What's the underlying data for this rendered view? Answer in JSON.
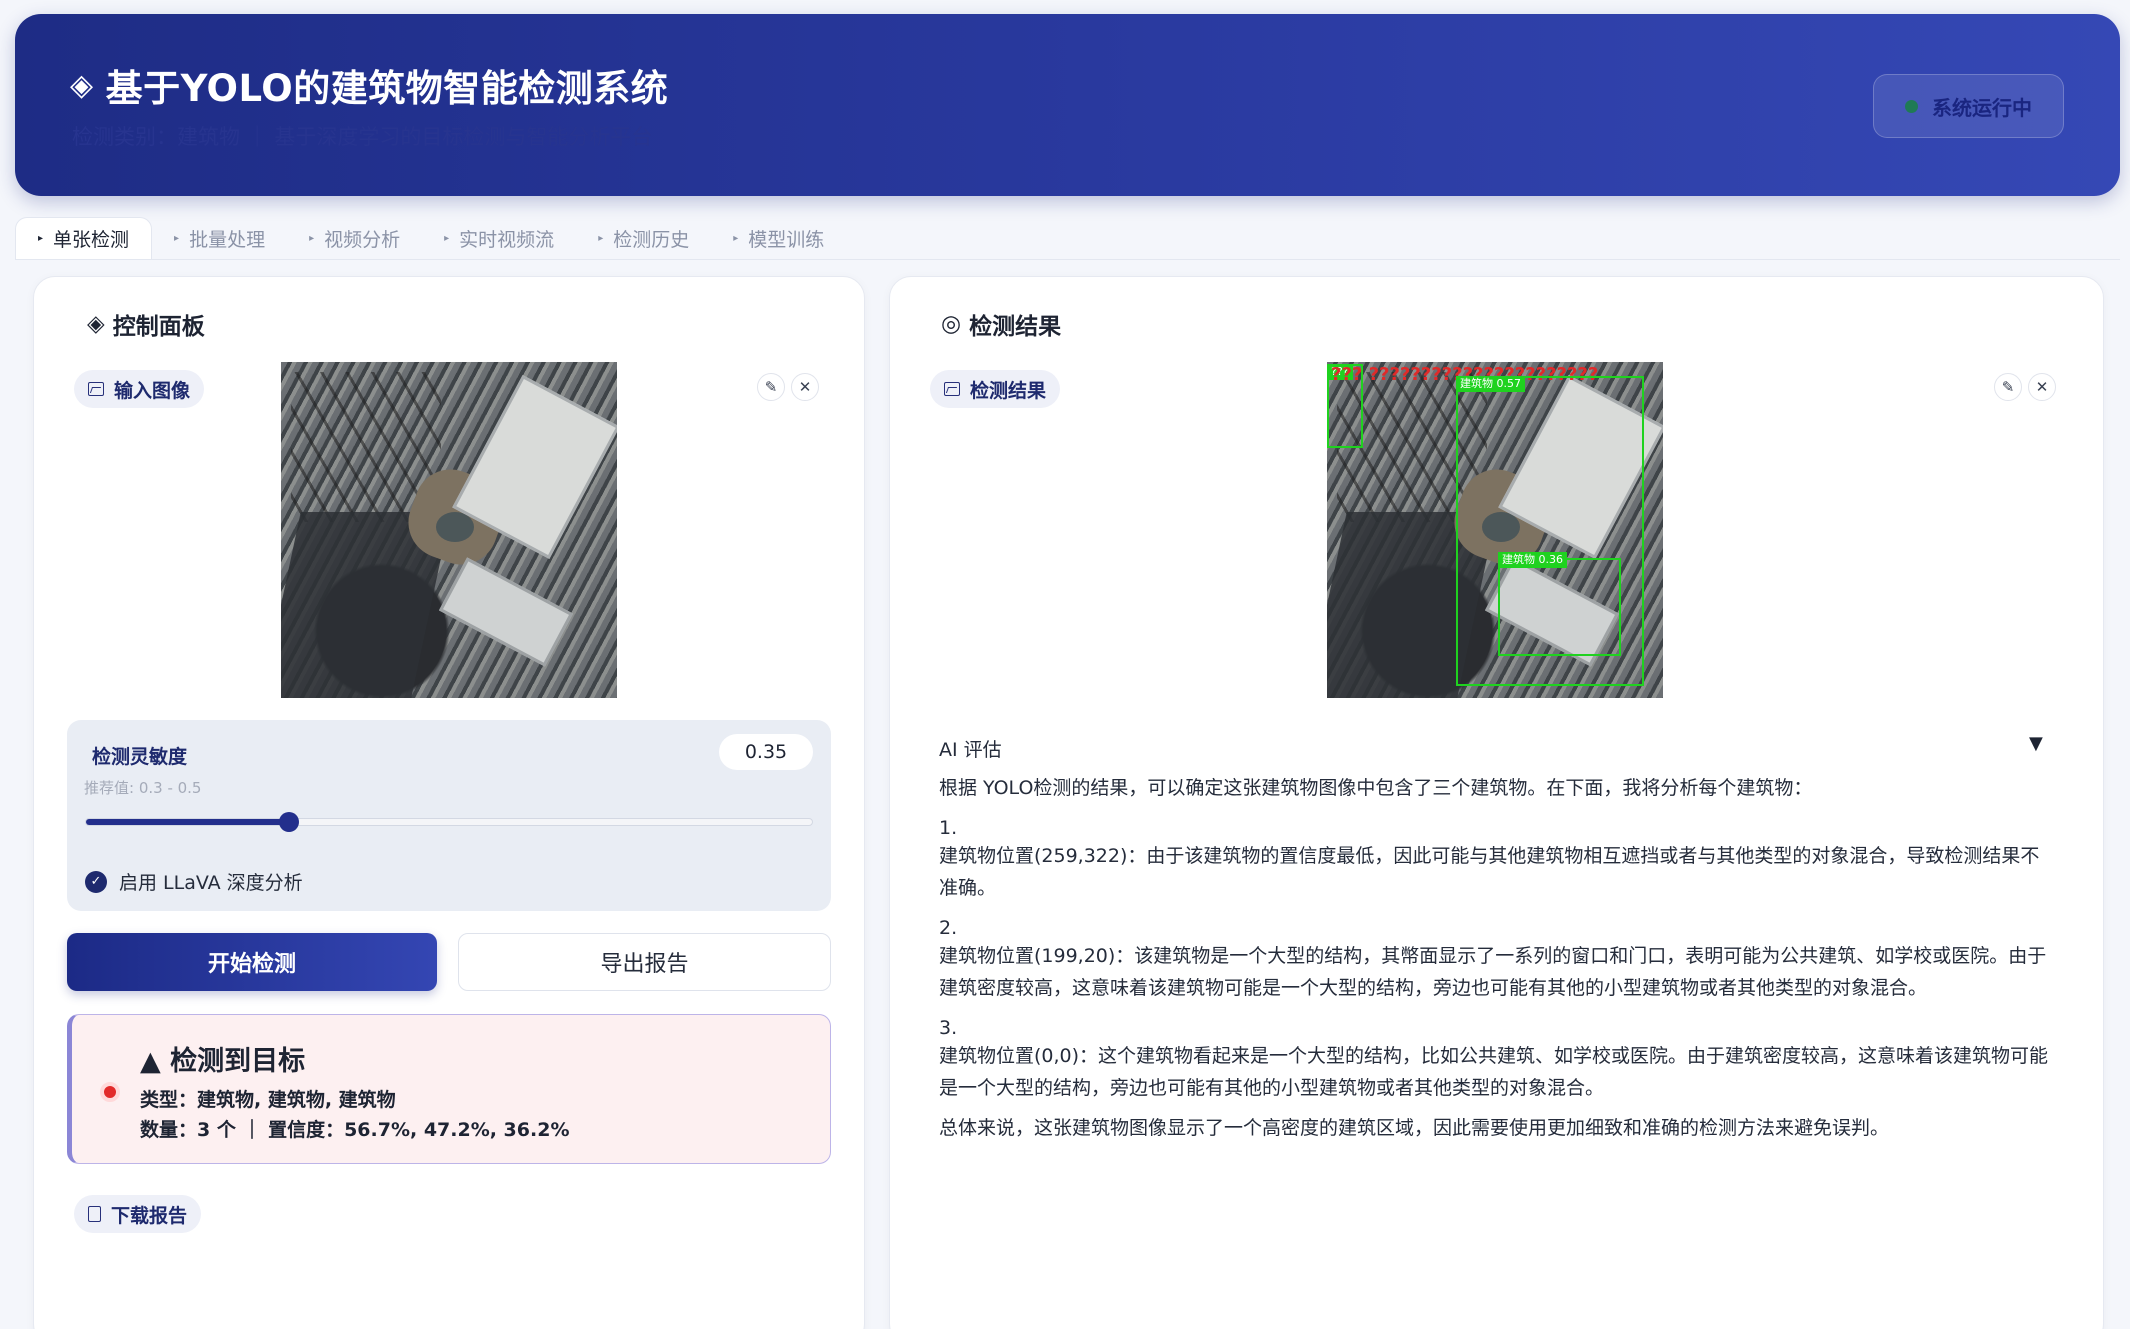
{
  "header": {
    "title": "基于YOLO的建筑物智能检测系统",
    "subtitle": "检测类别：建筑物 ｜ 基于深度学习的目标检测与智能分析平台",
    "status": "系统运行中"
  },
  "tabs": [
    {
      "label": "单张检测",
      "active": true
    },
    {
      "label": "批量处理"
    },
    {
      "label": "视频分析"
    },
    {
      "label": "实时视频流"
    },
    {
      "label": "检测历史"
    },
    {
      "label": "模型训练"
    }
  ],
  "control": {
    "title": "控制面板",
    "input_label": "输入图像",
    "sensitivity": {
      "label": "检测灵敏度",
      "hint": "推荐值: 0.3 - 0.5",
      "value": "0.35",
      "fraction": 0.28
    },
    "llava_label": "启用 LLaVA 深度分析",
    "llava_checked": true,
    "start_button": "开始检测",
    "export_button": "导出报告",
    "alert": {
      "title": "▲ 检测到目标",
      "types": "类型：建筑物, 建筑物, 建筑物",
      "summary": "数量：3 个 ｜ 置信度：56.7%, 47.2%, 36.2%"
    },
    "download_label": "下载报告"
  },
  "result": {
    "title": "检测结果",
    "chip_label": "检测结果",
    "detections": [
      {
        "label": "???",
        "garbled": "??? ??????????????????????"
      },
      {
        "label": "建筑物 0.57"
      },
      {
        "label": "建筑物 0.36"
      }
    ],
    "ai": {
      "heading": "AI 评估",
      "intro": "根据 YOLO检测的结果，可以确定这张建筑物图像中包含了三个建筑物。在下面，我将分析每个建筑物：",
      "items": [
        {
          "num": "1.",
          "text": "建筑物位置(259,322)：由于该建筑物的置信度最低，因此可能与其他建筑物相互遮挡或者与其他类型的对象混合，导致检测结果不准确。"
        },
        {
          "num": "2.",
          "text": "建筑物位置(199,20)：该建筑物是一个大型的结构，其幣面显示了一系列的窗口和门口，表明可能为公共建筑、如学校或医院。由于建筑密度较高，这意味着该建筑物可能是一个大型的结构，旁边也可能有其他的小型建筑物或者其他类型的对象混合。"
        },
        {
          "num": "3.",
          "text": "建筑物位置(0,0)：这个建筑物看起来是一个大型的结构，比如公共建筑、如学校或医院。由于建筑密度较高，这意味着该建筑物可能是一个大型的结构，旁边也可能有其他的小型建筑物或者其他类型的对象混合。"
        }
      ],
      "conclusion": "总体来说，这张建筑物图像显示了一个高密度的建筑区域，因此需要使用更加细致和准确的检测方法来避免误判。"
    }
  },
  "icons": {
    "title_diamond": "diamond-icon",
    "status": "status-dot-icon",
    "image": "image-icon",
    "edit": "pencil-icon",
    "close": "close-icon",
    "check": "check-icon",
    "document": "document-icon",
    "target": "target-icon",
    "collapse": "caret-down-icon"
  },
  "colors": {
    "brand": "#1e2c85",
    "accent": "#232f8c",
    "bbox": "#1fd21f",
    "alert_dot": "#e22a2a"
  }
}
